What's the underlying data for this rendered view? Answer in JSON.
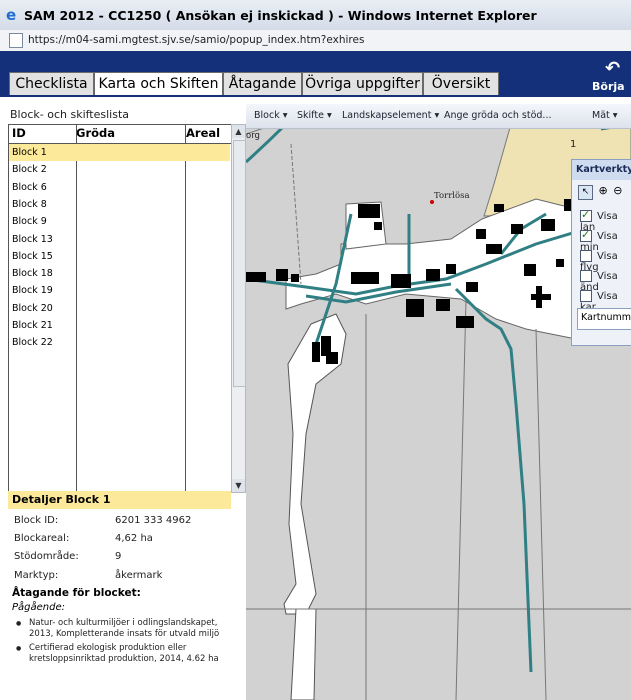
{
  "window": {
    "title": "SAM 2012 - CC1250 ( Ansökan ej inskickad ) - Windows Internet Explorer",
    "url": "https://m04-sami.mgtest.sjv.se/samio/popup_index.htm?exhires"
  },
  "tabs": [
    {
      "label": "Checklista"
    },
    {
      "label": "Karta och Skiften"
    },
    {
      "label": "Åtagande"
    },
    {
      "label": "Övriga uppgifter"
    },
    {
      "label": "Översikt"
    }
  ],
  "start_over_label": "Börja o",
  "list": {
    "title": "Block- och skifteslista",
    "columns": [
      "ID",
      "Gröda",
      "Areal"
    ],
    "rows": [
      "Block 1",
      "Block 2",
      "Block 6",
      "Block 8",
      "Block 9",
      "Block 13",
      "Block 15",
      "Block 18",
      "Block 19",
      "Block 20",
      "Block 21",
      "Block 22"
    ],
    "selected_index": 0
  },
  "details": {
    "title": "Detaljer Block 1",
    "fields": [
      {
        "label": "Block ID:",
        "value": "6201 333 4962"
      },
      {
        "label": "Blockareal:",
        "value": "4,62 ha"
      },
      {
        "label": "Stödområde:",
        "value": "9"
      },
      {
        "label": "Marktyp:",
        "value": "åkermark"
      }
    ],
    "commitments_title": "Åtagande för blocket:",
    "ongoing_label": "Pågående:",
    "items": [
      "Natur- och kulturmiljöer i odlingslandskapet, 2013, Kompletterande insats för utvald miljö",
      "Certifierad ekologisk produktion eller kretsloppsinriktad produktion, 2014, 4.62 ha"
    ]
  },
  "map_toolbar": {
    "items": [
      "Block",
      "Skifte",
      "Landskapselement",
      "Ange gröda och stöd...",
      "Mät"
    ]
  },
  "map": {
    "place_label": "Torrlösa",
    "corner_label": "org",
    "number_label": "1"
  },
  "map_tools": {
    "title": "Kartverkty",
    "checkboxes": [
      {
        "label": "Visa lan",
        "checked": true
      },
      {
        "label": "Visa min",
        "checked": true
      },
      {
        "label": "Visa flyg",
        "checked": false
      },
      {
        "label": "Visa änd",
        "checked": false
      },
      {
        "label": "Visa kar",
        "checked": false
      }
    ],
    "map_number_label": "Kartnumm"
  }
}
